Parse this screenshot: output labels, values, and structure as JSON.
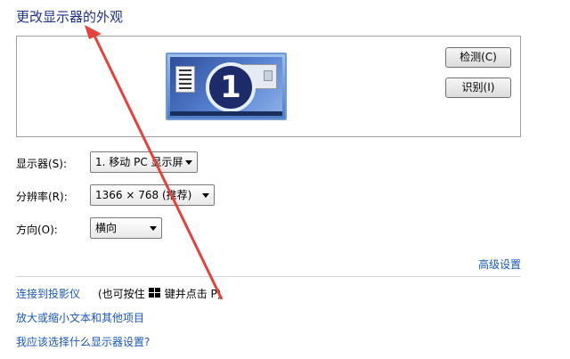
{
  "page": {
    "title": "更改显示器的外观"
  },
  "preview": {
    "monitor_number": "1"
  },
  "buttons": {
    "detect": "检测(C)",
    "identify": "识别(I)"
  },
  "settings": {
    "display": {
      "label": "显示器(S):",
      "value": "1. 移动 PC 显示屏"
    },
    "resolution": {
      "label": "分辨率(R):",
      "value": "1366 × 768 (推荐)"
    },
    "orientation": {
      "label": "方向(O):",
      "value": "横向"
    }
  },
  "advanced_link": "高级设置",
  "links": {
    "projector": "连接到投影仪",
    "projector_note_before": "(也可按住",
    "projector_note_after": "键并点击 P)",
    "text_size": "放大或缩小文本和其他项目",
    "which_settings": "我应该选择什么显示器设置?"
  },
  "icons": {
    "windows_key": "windows-logo-icon",
    "annotation": "red-arrow-annotation"
  },
  "colors": {
    "title": "#1e3287",
    "link": "#1a57b8",
    "annotation": "#e8403a"
  }
}
